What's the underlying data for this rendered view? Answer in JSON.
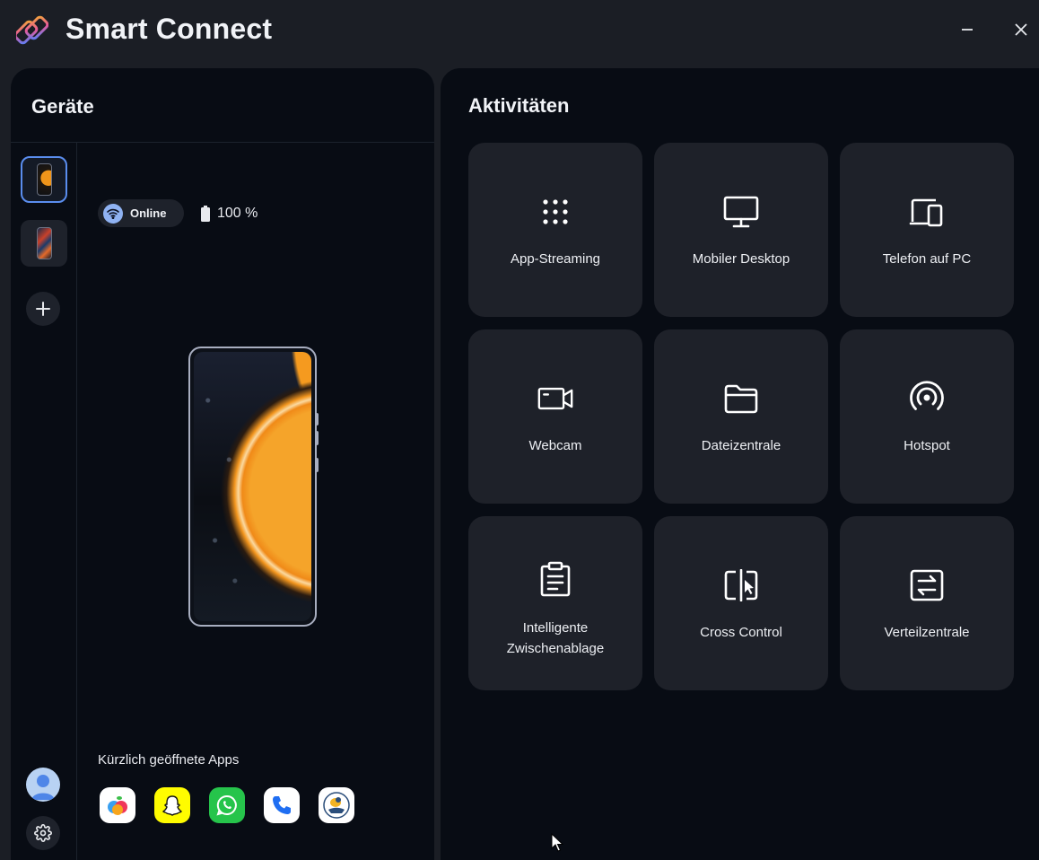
{
  "app": {
    "title": "Smart Connect",
    "accent": "#5a8dee",
    "icons": {
      "logo": "smart-connect-logo-icon",
      "minimize": "minimize-icon",
      "close": "close-icon"
    }
  },
  "devices_panel": {
    "title": "Geräte",
    "devices": [
      {
        "id": "device-1",
        "selected": true
      },
      {
        "id": "device-2",
        "selected": false
      }
    ],
    "status": {
      "connection": "Online",
      "battery": "100 %"
    },
    "recent_apps_label": "Kürzlich geöffnete Apps",
    "recent_apps": [
      {
        "icon": "fruit-app-icon"
      },
      {
        "icon": "snapchat-icon"
      },
      {
        "icon": "whatsapp-icon"
      },
      {
        "icon": "phone-app-icon"
      },
      {
        "icon": "bird-app-icon"
      }
    ]
  },
  "activities_panel": {
    "title": "Aktivitäten",
    "tiles": [
      {
        "label": "App-Streaming",
        "icon": "app-grid-icon"
      },
      {
        "label": "Mobiler Desktop",
        "icon": "monitor-icon"
      },
      {
        "label": "Telefon auf PC",
        "icon": "phone-to-pc-icon"
      },
      {
        "label": "Webcam",
        "icon": "video-camera-icon"
      },
      {
        "label": "Dateizentrale",
        "icon": "folder-icon"
      },
      {
        "label": "Hotspot",
        "icon": "hotspot-icon"
      },
      {
        "label": "Intelligente\nZwischenablage",
        "icon": "clipboard-icon"
      },
      {
        "label": "Cross Control",
        "icon": "cross-control-icon"
      },
      {
        "label": "Verteilzentrale",
        "icon": "share-hub-icon"
      }
    ]
  }
}
